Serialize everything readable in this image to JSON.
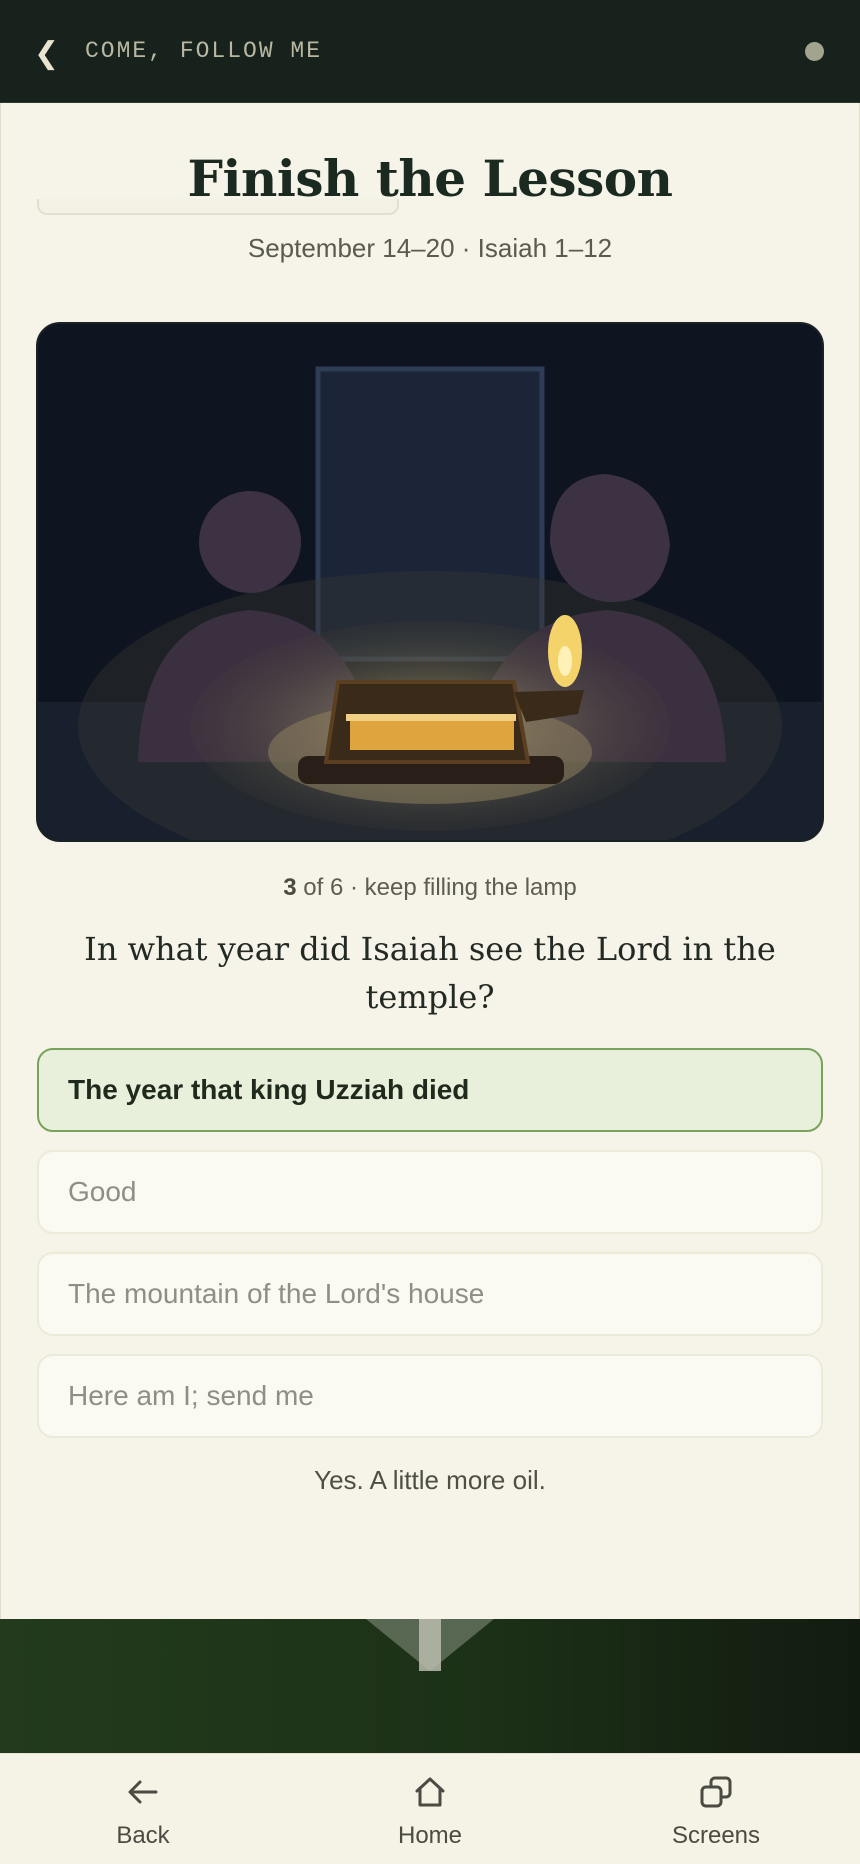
{
  "header": {
    "back_glyph": "❮",
    "title": "COME, FOLLOW ME"
  },
  "lesson": {
    "title": "Finish the Lesson",
    "subtitle": "September 14–20 · Isaiah 1–12"
  },
  "progress": {
    "current": "3",
    "text": " of 6 · keep filling the lamp"
  },
  "question": {
    "text": "In what year did Isaiah see the Lord in the temple?",
    "options": [
      {
        "label": "The year that king Uzziah died",
        "state": "correct"
      },
      {
        "label": "Good",
        "state": "disabled"
      },
      {
        "label": "The mountain of the Lord's house",
        "state": "disabled"
      },
      {
        "label": "Here am I; send me",
        "state": "disabled"
      }
    ],
    "feedback": "Yes. A little more oil."
  },
  "nav": {
    "items": [
      {
        "label": "Back",
        "icon": "arrow-left-icon"
      },
      {
        "label": "Home",
        "icon": "home-icon"
      },
      {
        "label": "Screens",
        "icon": "screens-icon"
      }
    ]
  },
  "colors": {
    "header_bg": "#17221d",
    "page_bg": "#f6f3e8",
    "correct_bg": "#e8f0dc",
    "correct_border": "#78a35a",
    "lamp_flame": "#f4d46a"
  }
}
